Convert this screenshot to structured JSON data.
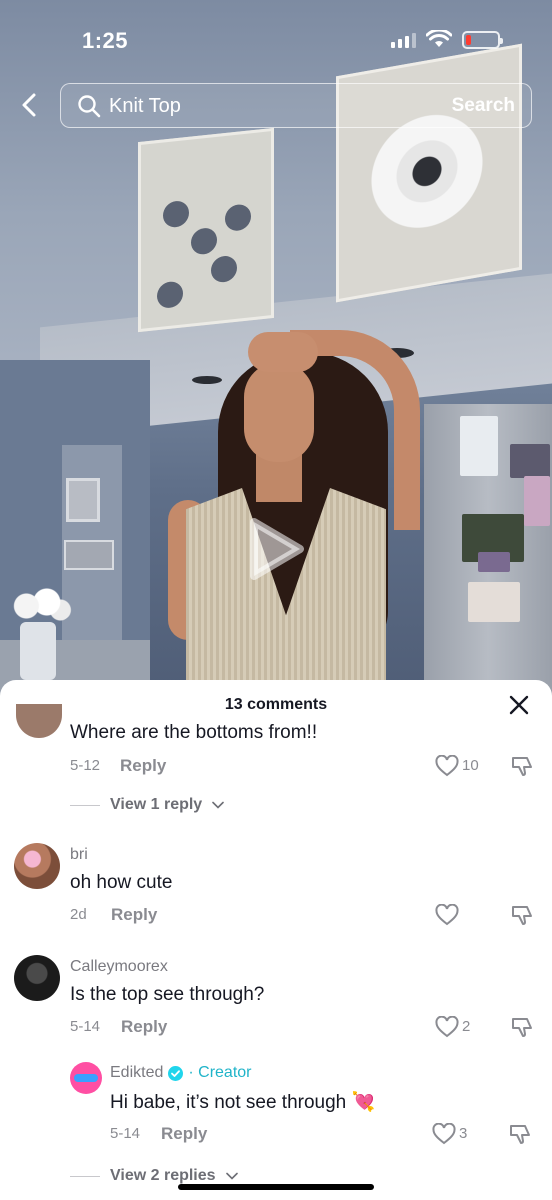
{
  "status_bar": {
    "time": "1:25"
  },
  "search": {
    "query": "Knit Top",
    "button_label": "Search"
  },
  "comments_sheet": {
    "title": "13 comments",
    "comments": [
      {
        "text": "Where are the bottoms from!!",
        "date": "5-12",
        "reply_label": "Reply",
        "likes": "10",
        "view_replies": "View 1 reply"
      },
      {
        "username": "bri",
        "text": "oh how cute",
        "date": "2d",
        "reply_label": "Reply",
        "likes": ""
      },
      {
        "username": "Calleymoorex",
        "text": "Is the top see through?",
        "date": "5-14",
        "reply_label": "Reply",
        "likes": "2",
        "reply": {
          "username": "Edikted",
          "creator_tag": "· Creator",
          "text": "Hi babe, it’s not see through 💘",
          "date": "5-14",
          "reply_label": "Reply",
          "likes": "3"
        },
        "view_replies": "View 2 replies"
      }
    ]
  },
  "colors": {
    "creator_accent": "#20b4c9",
    "verified_badge": "#20d5ec",
    "battery_low": "#ff3b30",
    "edikted_avatar": "#ff4fa3"
  },
  "icons": [
    "back-arrow-icon",
    "search-icon",
    "play-icon",
    "close-icon",
    "heart-icon",
    "dislike-icon",
    "verified-icon",
    "chevron-down-icon"
  ]
}
